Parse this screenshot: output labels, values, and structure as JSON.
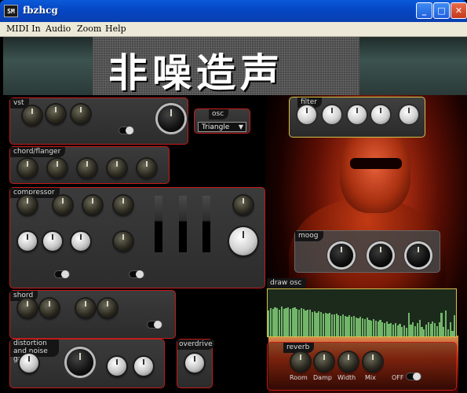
{
  "window": {
    "title": "fbzhcg",
    "app_icon": "SM",
    "minimize": "_",
    "maximize": "□",
    "close": "✕"
  },
  "menu": [
    "MIDI In",
    "Audio",
    "Zoom",
    "Help"
  ],
  "header": {
    "logo_text": "非噪造声"
  },
  "panels": {
    "vst": {
      "label": "vst"
    },
    "osc": {
      "label": "osc",
      "waveform": "Triangle",
      "arrow": "▼"
    },
    "filter": {
      "label": "filter"
    },
    "chord_flanger": {
      "label": "chord/flanger"
    },
    "compressor": {
      "label": "compressor"
    },
    "moog": {
      "label": "moog"
    },
    "draw_osc": {
      "label": "draw osc"
    },
    "shord": {
      "label": "shord"
    },
    "distortion": {
      "label": "distortion and noise gate"
    },
    "overdrive": {
      "label": "overdrive"
    },
    "reverb": {
      "label": "reverb",
      "params": [
        "Room",
        "Damp",
        "Width",
        "Mix"
      ],
      "toggle_label": "OFF"
    }
  },
  "draw_osc_values": [
    0.55,
    0.6,
    0.58,
    0.62,
    0.6,
    0.57,
    0.63,
    0.59,
    0.6,
    0.61,
    0.58,
    0.6,
    0.62,
    0.59,
    0.57,
    0.6,
    0.58,
    0.55,
    0.57,
    0.56,
    0.52,
    0.54,
    0.5,
    0.53,
    0.51,
    0.49,
    0.5,
    0.48,
    0.5,
    0.47,
    0.46,
    0.48,
    0.45,
    0.44,
    0.47,
    0.43,
    0.42,
    0.45,
    0.41,
    0.43,
    0.4,
    0.39,
    0.42,
    0.38,
    0.36,
    0.4,
    0.35,
    0.34,
    0.37,
    0.33,
    0.32,
    0.35,
    0.3,
    0.28,
    0.31,
    0.27,
    0.29,
    0.25,
    0.28,
    0.24,
    0.26,
    0.2,
    0.23,
    0.18,
    0.5,
    0.25,
    0.3,
    0.22,
    0.28,
    0.35,
    0.2,
    0.15,
    0.25,
    0.3,
    0.26,
    0.32,
    0.28,
    0.22,
    0.3,
    0.5,
    0.2,
    0.55,
    0.15,
    0.3,
    0.12,
    0.45
  ],
  "colors": {
    "panel_border": "#c41a1a",
    "filter_border": "#d4c14a",
    "graph_fill": "#72b66a"
  }
}
